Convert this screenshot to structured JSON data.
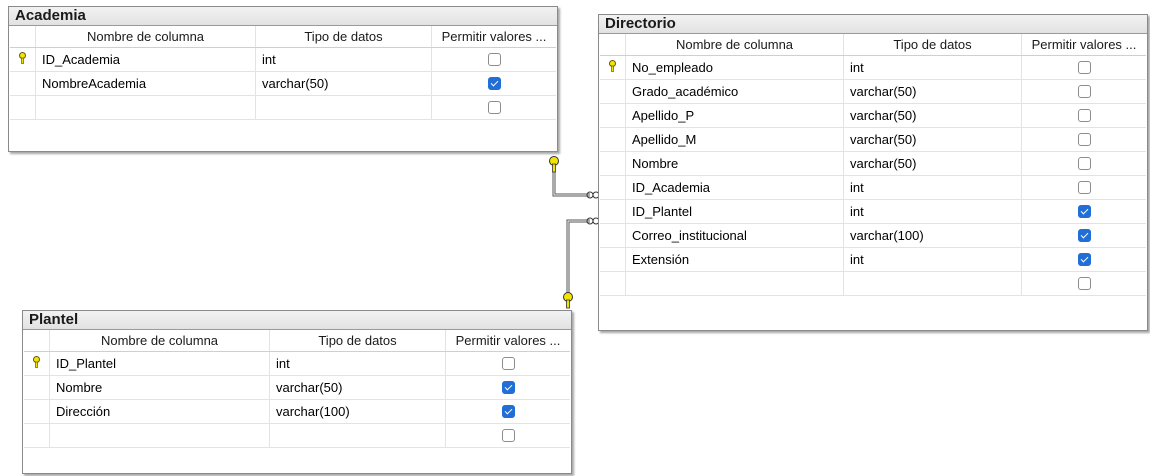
{
  "headers": {
    "name": "Nombre de columna",
    "type": "Tipo de datos",
    "nulls_short": "Permitir valores ...",
    "nulls_long": "Permitir valores ..."
  },
  "tables": {
    "academia": {
      "title": "Academia",
      "rows": [
        {
          "key": true,
          "name": "ID_Academia",
          "type": "int",
          "nullable": false
        },
        {
          "key": false,
          "name": "NombreAcademia",
          "type": "varchar(50)",
          "nullable": true
        },
        {
          "key": false,
          "name": "",
          "type": "",
          "nullable": false
        }
      ]
    },
    "directorio": {
      "title": "Directorio",
      "rows": [
        {
          "key": true,
          "name": "No_empleado",
          "type": "int",
          "nullable": false
        },
        {
          "key": false,
          "name": "Grado_académico",
          "type": "varchar(50)",
          "nullable": false
        },
        {
          "key": false,
          "name": "Apellido_P",
          "type": "varchar(50)",
          "nullable": false
        },
        {
          "key": false,
          "name": "Apellido_M",
          "type": "varchar(50)",
          "nullable": false
        },
        {
          "key": false,
          "name": "Nombre",
          "type": "varchar(50)",
          "nullable": false
        },
        {
          "key": false,
          "name": "ID_Academia",
          "type": "int",
          "nullable": false
        },
        {
          "key": false,
          "name": "ID_Plantel",
          "type": "int",
          "nullable": true
        },
        {
          "key": false,
          "name": "Correo_institucional",
          "type": "varchar(100)",
          "nullable": true
        },
        {
          "key": false,
          "name": "Extensión",
          "type": "int",
          "nullable": true
        },
        {
          "key": false,
          "name": "",
          "type": "",
          "nullable": false
        }
      ]
    },
    "plantel": {
      "title": "Plantel",
      "rows": [
        {
          "key": true,
          "name": "ID_Plantel",
          "type": "int",
          "nullable": false
        },
        {
          "key": false,
          "name": "Nombre",
          "type": "varchar(50)",
          "nullable": true
        },
        {
          "key": false,
          "name": "Dirección",
          "type": "varchar(100)",
          "nullable": true
        },
        {
          "key": false,
          "name": "",
          "type": "",
          "nullable": false
        }
      ]
    }
  },
  "relationships": [
    {
      "from": "academia",
      "to": "directorio"
    },
    {
      "from": "plantel",
      "to": "directorio"
    }
  ],
  "colors": {
    "key": "#e8d800",
    "check": "#1f6fd6",
    "line": "#555555"
  }
}
